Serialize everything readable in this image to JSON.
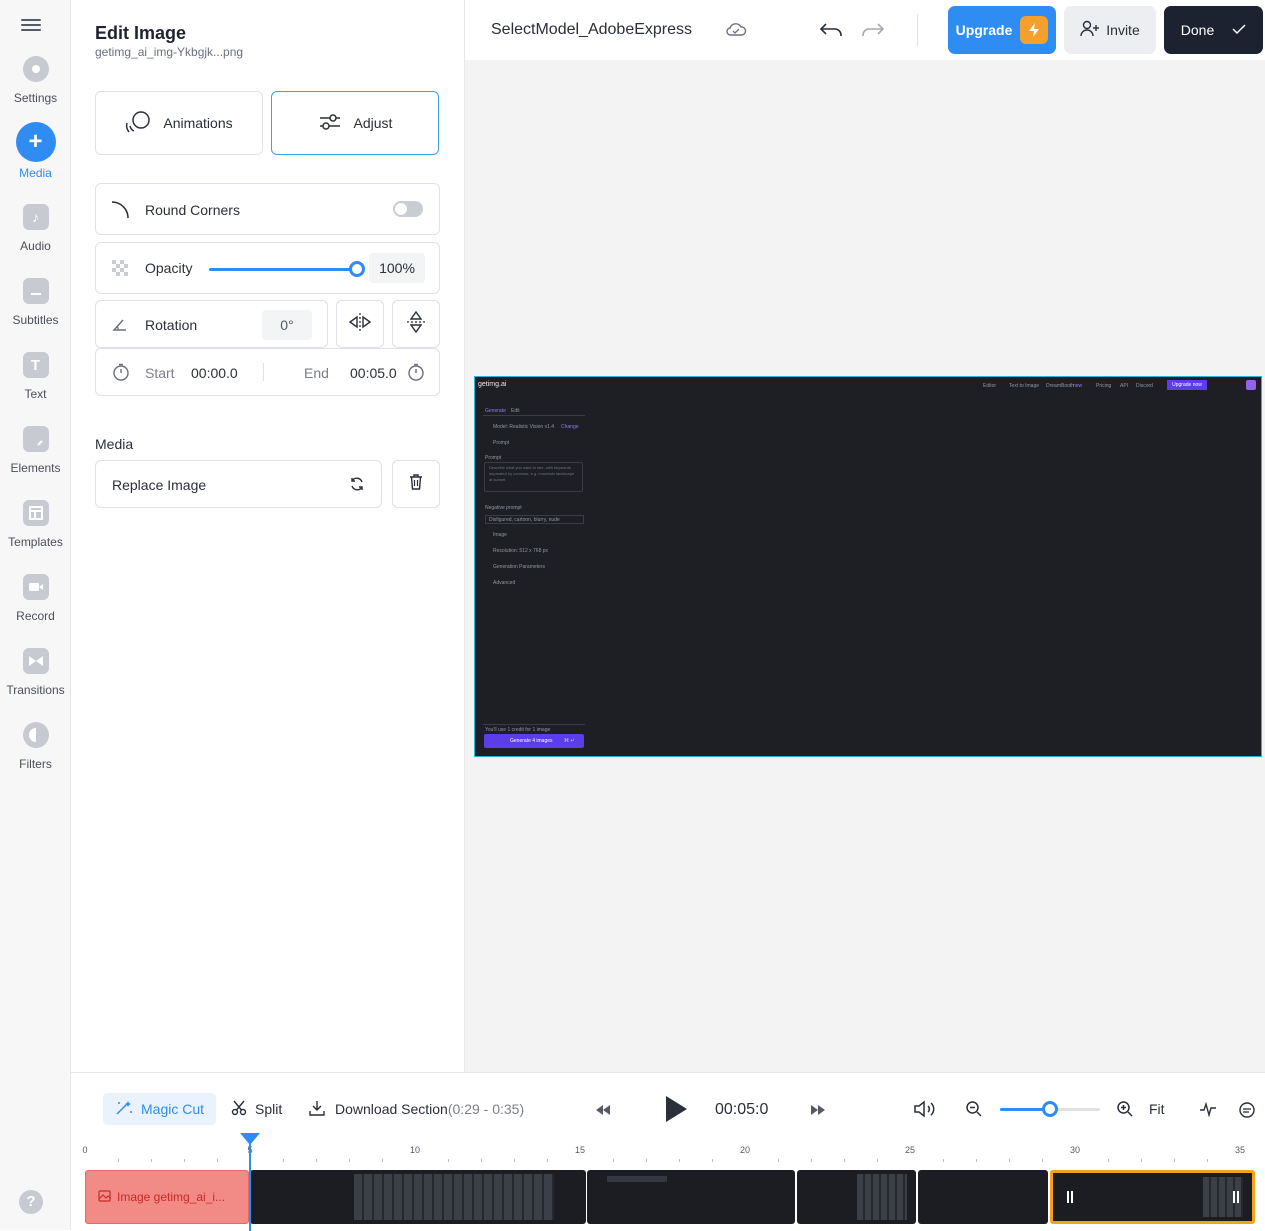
{
  "rail": {
    "items": [
      {
        "label": "Settings"
      },
      {
        "label": "Media"
      },
      {
        "label": "Audio"
      },
      {
        "label": "Subtitles"
      },
      {
        "label": "Text"
      },
      {
        "label": "Elements"
      },
      {
        "label": "Templates"
      },
      {
        "label": "Record"
      },
      {
        "label": "Transitions"
      },
      {
        "label": "Filters"
      }
    ],
    "help": "?"
  },
  "panel": {
    "title": "Edit Image",
    "filename": "getimg_ai_img-Ykbgjk...png",
    "tabs": {
      "animations": "Animations",
      "adjust": "Adjust"
    },
    "round_corners": {
      "label": "Round Corners",
      "enabled": false
    },
    "opacity": {
      "label": "Opacity",
      "value": "100%",
      "fraction": 1.0
    },
    "rotation": {
      "label": "Rotation",
      "value": "0°"
    },
    "timing": {
      "start_label": "Start",
      "start": "00:00.0",
      "end_label": "End",
      "end": "00:05.0"
    },
    "media": {
      "heading": "Media",
      "replace": "Replace Image"
    }
  },
  "topbar": {
    "project": "SelectModel_AdobeExpress",
    "upgrade": "Upgrade",
    "invite": "Invite",
    "done": "Done"
  },
  "preview": {
    "brand": "getimg.ai",
    "nav": [
      "Editor",
      "Text to Image",
      "DreamBooth",
      "Pricing",
      "API",
      "Discord"
    ],
    "nav_badge": "new",
    "upgrade_btn": "Upgrade now",
    "tabs": [
      "Generate",
      "Edit"
    ],
    "model": "Model: Realistic Vision v1.4",
    "model_change": "Change",
    "sections": [
      "Prompt",
      "Image",
      "Resolution: 512 x 768 px",
      "Generation Parameters",
      "Advanced"
    ],
    "prompt_label": "Prompt",
    "prompt_placeholder": "Describe what you want to see, with keywords separated by commas, e.g. mountain landscape at sunset",
    "negative_label": "Negative prompt",
    "negative_value": "Disfigured, cartoon, blurry, nude",
    "footer_text": "You'll use 1 credit for 1 image",
    "generate_btn": "Generate 4 images",
    "generate_shortcut": "⌘ ↵"
  },
  "timeline": {
    "magic_cut": "Magic Cut",
    "split": "Split",
    "download": "Download Section",
    "download_range": "(0:29 - 0:35)",
    "time": "00:05:0",
    "fit": "Fit",
    "zoom_fraction": 0.5,
    "ruler": [
      "0",
      "5",
      "10",
      "15",
      "20",
      "25",
      "30",
      "35"
    ],
    "clip_label": "Image getimg_ai_i..."
  },
  "colors": {
    "accent": "#2f8cf3",
    "dark": "#1c2230",
    "selection": "#f4a21a",
    "image_clip": "#f28a86",
    "preview_border": "#28b3d8"
  }
}
